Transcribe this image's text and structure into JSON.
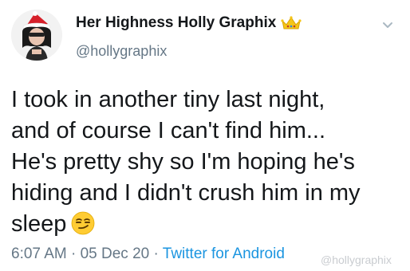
{
  "user": {
    "display_name": "Her Highness Holly Graphix",
    "handle": "@hollygraphix",
    "badge_icon": "crown-icon"
  },
  "tweet": {
    "lines": [
      "I took in another tiny last night,",
      "and of course I can't find him...",
      "He's pretty shy so I'm hoping he's",
      "hiding and I didn't crush him in my",
      "sleep"
    ],
    "emoji_icon": "smirking-face-icon"
  },
  "meta": {
    "time": "6:07 AM",
    "separator": " · ",
    "date": "05 Dec 20",
    "source": "Twitter for Android"
  },
  "watermark": "@hollygraphix",
  "colors": {
    "text": "#14171a",
    "secondary": "#657786",
    "link": "#1b95e0"
  }
}
